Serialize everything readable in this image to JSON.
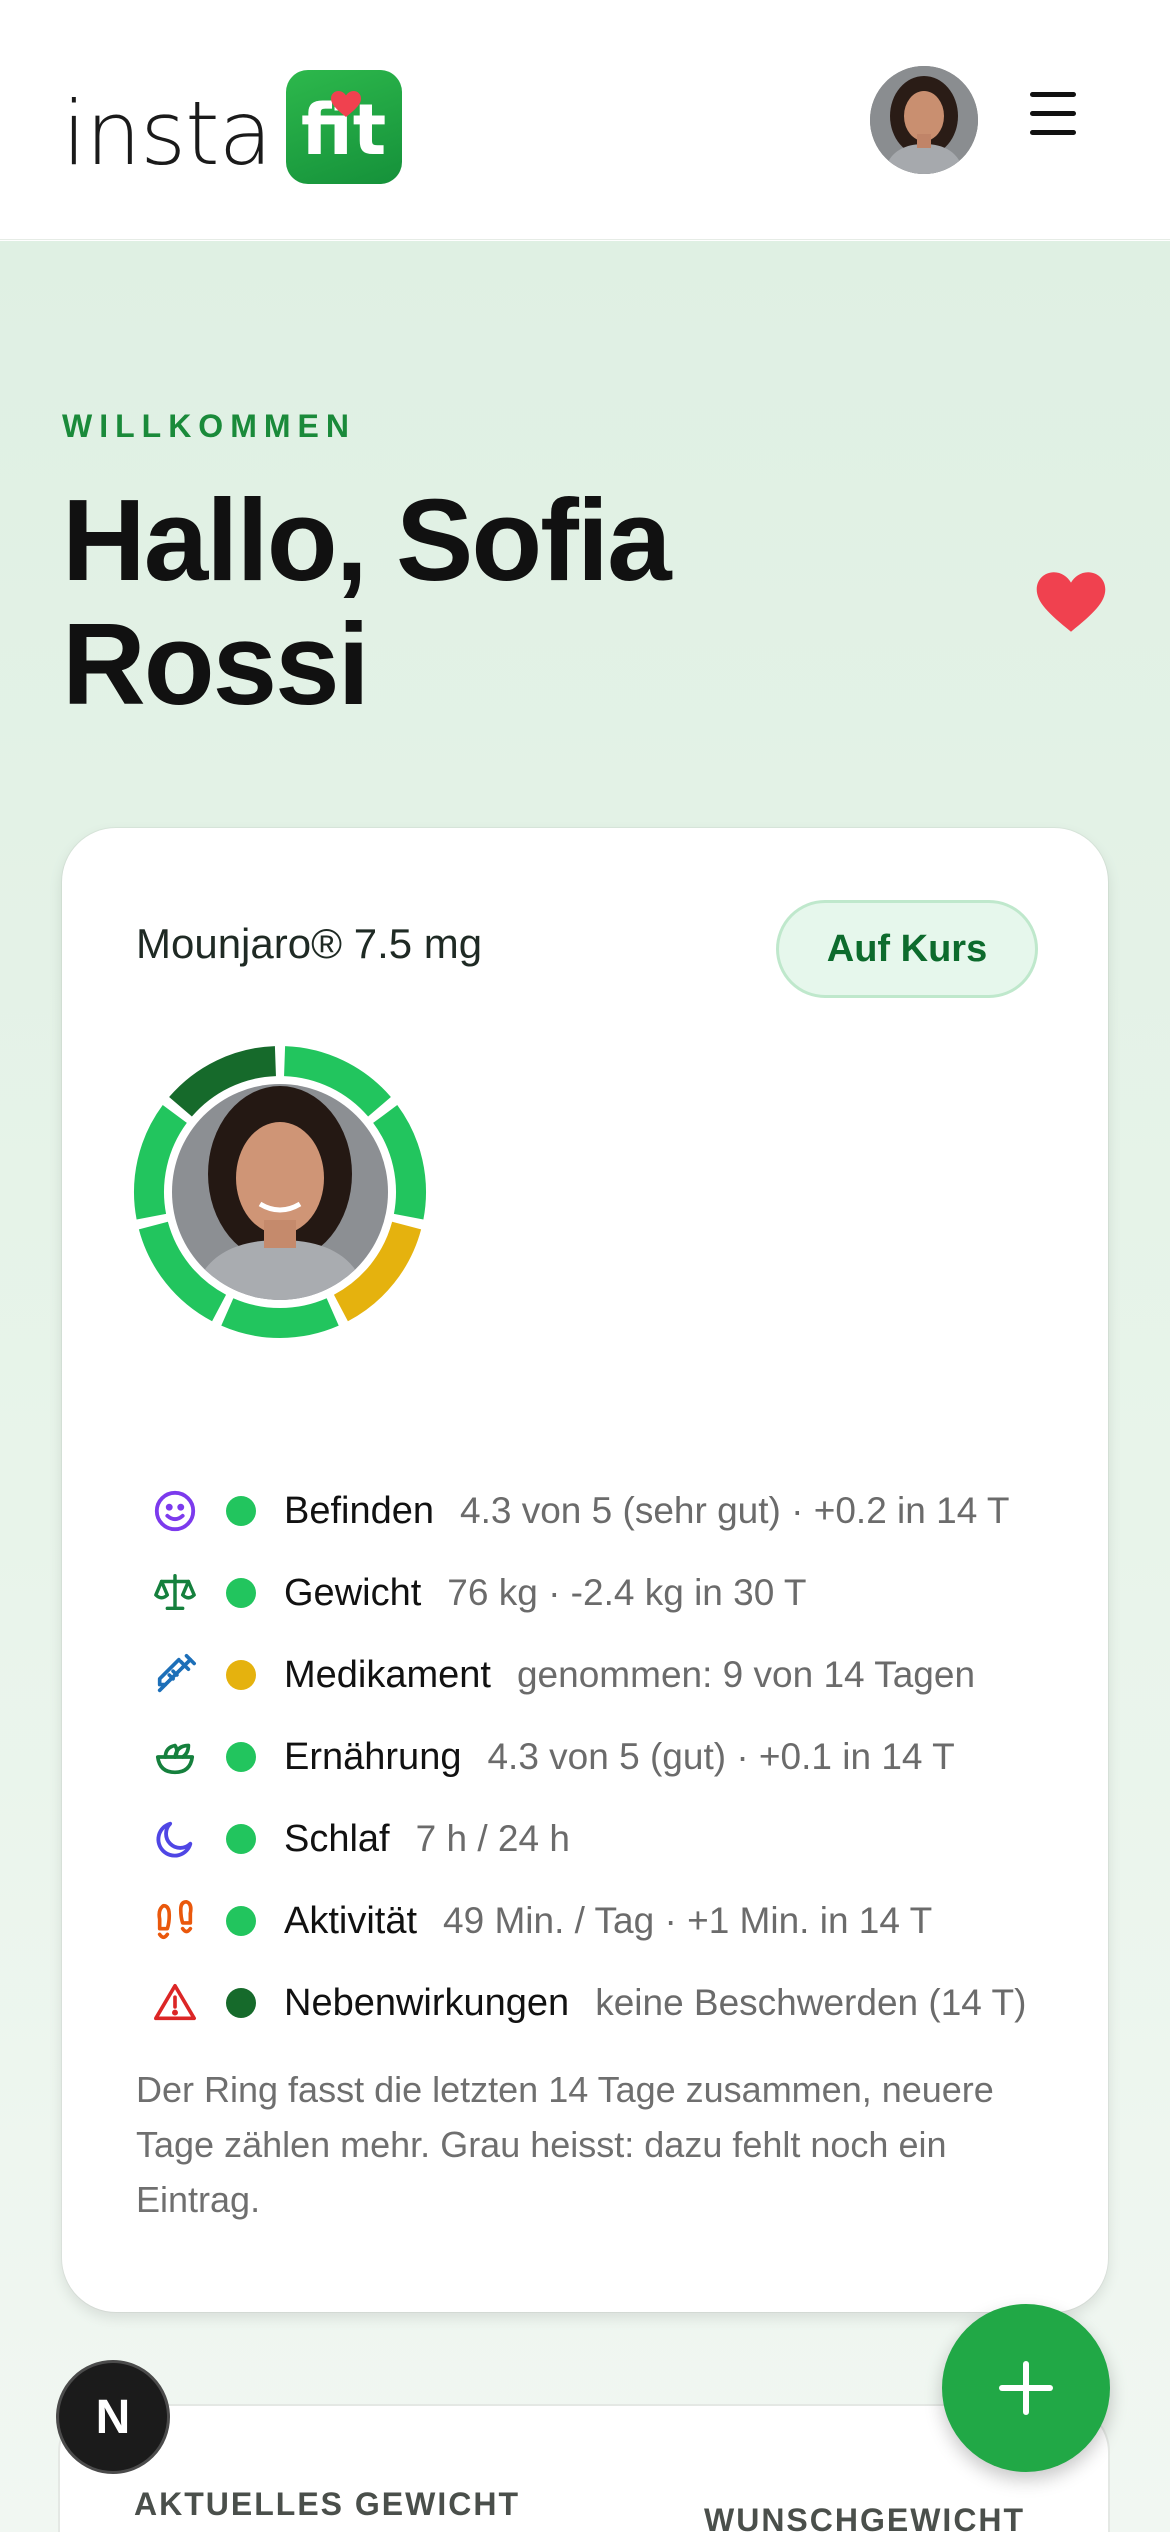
{
  "header": {
    "logo_text": "insta",
    "logo_badge_text": "fit",
    "avatar_alt": "Sofia Rossi",
    "menu_icon": "hamburger-menu-icon"
  },
  "hero": {
    "eyebrow": "WILLKOMMEN",
    "greeting": "Hallo, Sofia Rossi"
  },
  "card": {
    "medication": "Mounjaro® 7.5 mg",
    "status": "Auf Kurs",
    "ring_segments": [
      {
        "label": "Befinden",
        "color": "#22c55e"
      },
      {
        "label": "Gewicht",
        "color": "#22c55e"
      },
      {
        "label": "Medikament",
        "color": "#e5b20e"
      },
      {
        "label": "Ernährung",
        "color": "#22c55e"
      },
      {
        "label": "Schlaf",
        "color": "#22c55e"
      },
      {
        "label": "Aktivität",
        "color": "#22c55e"
      },
      {
        "label": "Nebenwirkungen",
        "color": "#166a2b"
      }
    ],
    "metrics": [
      {
        "icon": "smiley-icon",
        "status_color": "#22c55e",
        "label": "Befinden",
        "value": "4.3 von 5 (sehr gut) · +0.2 in 14 T"
      },
      {
        "icon": "scale-icon",
        "status_color": "#22c55e",
        "label": "Gewicht",
        "value": "76 kg · -2.4 kg in 30 T"
      },
      {
        "icon": "syringe-icon",
        "status_color": "#e5b20e",
        "label": "Medikament",
        "value": "genommen: 9 von 14 Tagen"
      },
      {
        "icon": "salad-bowl-icon",
        "status_color": "#22c55e",
        "label": "Ernährung",
        "value": "4.3 von 5 (gut) · +0.1 in 14 T"
      },
      {
        "icon": "moon-icon",
        "status_color": "#22c55e",
        "label": "Schlaf",
        "value": "7 h / 24 h"
      },
      {
        "icon": "footprints-icon",
        "status_color": "#22c55e",
        "label": "Aktivität",
        "value": "49 Min. / Tag · +1 Min. in 14 T"
      },
      {
        "icon": "warning-triangle-icon",
        "status_color": "#166a2b",
        "label": "Nebenwirkungen",
        "value": "keine Beschwerden (14 T)"
      }
    ],
    "footnote": "Der Ring fasst die letzten 14 Tage zusammen, neuere Tage zählen mehr. Grau heisst: dazu fehlt noch ein Eintrag."
  },
  "card2": {
    "current_weight_label": "AKTUELLES GEWICHT",
    "target_weight_label": "WUNSCHGEWICHT"
  },
  "fab": {
    "icon": "plus-icon"
  },
  "badge": {
    "text": "N"
  }
}
